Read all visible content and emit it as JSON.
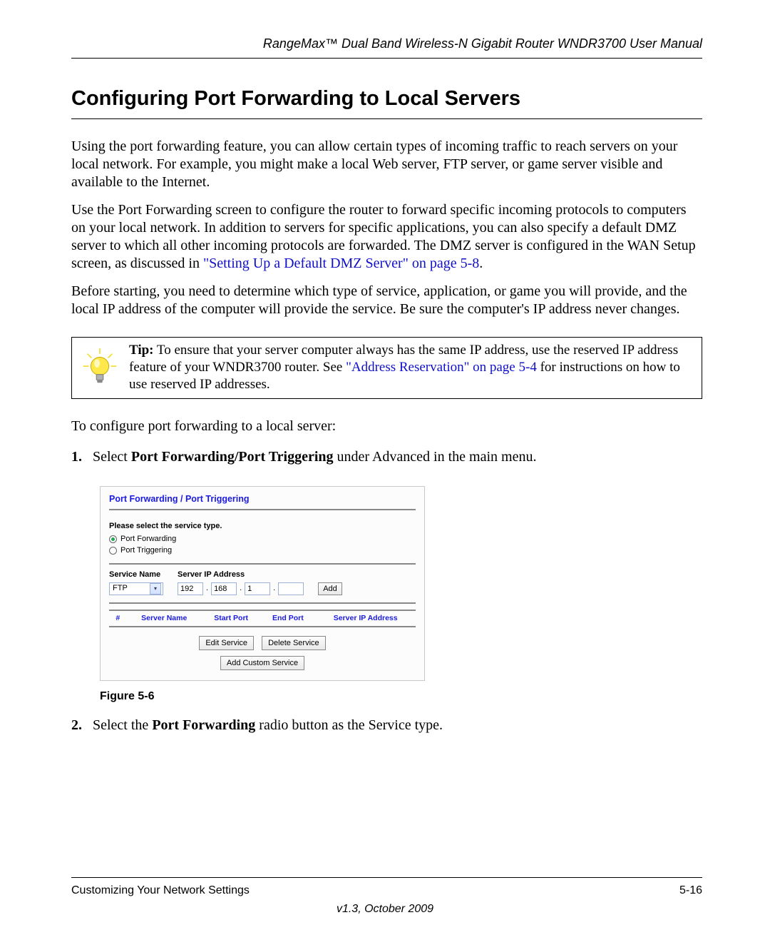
{
  "header": "RangeMax™ Dual Band Wireless-N Gigabit Router WNDR3700 User Manual",
  "title": "Configuring Port Forwarding to Local Servers",
  "para1": "Using the port forwarding feature, you can allow certain types of incoming traffic to reach servers on your local network. For example, you might make a local Web server, FTP server, or game server visible and available to the Internet.",
  "para2a": "Use the Port Forwarding screen to configure the router to forward specific incoming protocols to computers on your local network. In addition to servers for specific applications, you can also specify a default DMZ server to which all other incoming protocols are forwarded. The DMZ server is configured in the WAN Setup screen, as discussed in ",
  "para2_link": "\"Setting Up a Default DMZ Server\" on page 5-8",
  "para2b": ".",
  "para3": "Before starting, you need to determine which type of service, application, or game you will provide, and the local IP address of the computer will provide the service. Be sure the computer's IP address never changes.",
  "tip": {
    "prefix": "Tip:",
    "text1": " To ensure that your server computer always has the same IP address, use the reserved IP address feature of your WNDR3700 router. See ",
    "link": "\"Address Reservation\" on page 5-4",
    "text2": " for instructions on how to use reserved IP addresses."
  },
  "intro_steps": "To configure port forwarding to a local server:",
  "steps": {
    "s1": {
      "num": "1.",
      "pre": "Select ",
      "bold": "Port Forwarding/Port Triggering",
      "post": " under Advanced in the main menu."
    },
    "s2": {
      "num": "2.",
      "pre": "Select the ",
      "bold": "Port Forwarding",
      "post": " radio button as the Service type."
    }
  },
  "figure": {
    "caption": "Figure 5-6",
    "panel_title": "Port Forwarding / Port Triggering",
    "select_label": "Please select the service type.",
    "radio1": "Port Forwarding",
    "radio2": "Port Triggering",
    "service_name_label": "Service Name",
    "ip_label": "Server IP Address",
    "service_selected": "FTP",
    "ip": {
      "o1": "192",
      "o2": "168",
      "o3": "1",
      "o4": ""
    },
    "add_btn": "Add",
    "table_headers": {
      "c1": "#",
      "c2": "Server Name",
      "c3": "Start Port",
      "c4": "End Port",
      "c5": "Server IP Address"
    },
    "edit_btn": "Edit Service",
    "delete_btn": "Delete Service",
    "custom_btn": "Add Custom Service"
  },
  "footer": {
    "left": "Customizing Your Network Settings",
    "right": "5-16",
    "version": "v1.3, October 2009"
  }
}
